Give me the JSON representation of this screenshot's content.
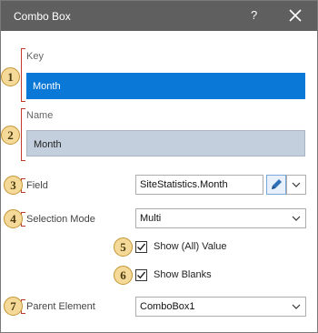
{
  "window": {
    "title": "Combo Box",
    "help_glyph": "?",
    "close_icon": "close-icon"
  },
  "key": {
    "label": "Key",
    "value": "Month",
    "badge": "1"
  },
  "name": {
    "label": "Name",
    "value": "Month",
    "badge": "2"
  },
  "field": {
    "label": "Field",
    "value": "SiteStatistics.Month",
    "badge": "3"
  },
  "selection_mode": {
    "label": "Selection Mode",
    "value": "Multi",
    "badge": "4"
  },
  "show_all": {
    "label": "Show (All) Value",
    "checked": true,
    "badge": "5"
  },
  "show_blanks": {
    "label": "Show Blanks",
    "checked": true,
    "badge": "6"
  },
  "parent_element": {
    "label": "Parent Element",
    "value": "ComboBox1",
    "badge": "7"
  },
  "colors": {
    "titlebar": "#5f5f5f",
    "selection": "#0a78d7",
    "name_field": "#c3cfdc",
    "badge_fill": "#f5d998",
    "bracket": "#c0392b"
  }
}
